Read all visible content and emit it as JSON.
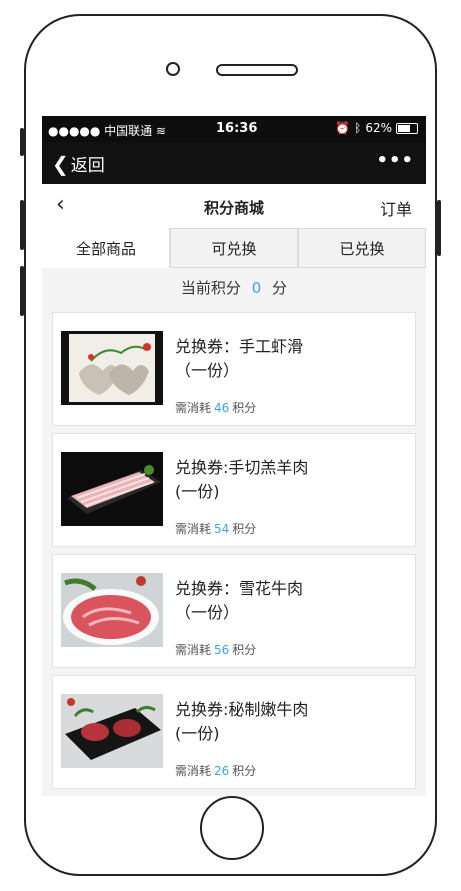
{
  "status": {
    "carrier": "●●●●● 中国联通",
    "time": "16:36",
    "battery": "62%"
  },
  "nav": {
    "back_label": "返回",
    "more_label": "•••"
  },
  "titlebar": {
    "title": "积分商城",
    "orders": "订单"
  },
  "tabs": [
    {
      "label": "全部商品",
      "active": true
    },
    {
      "label": "可兑换",
      "active": false
    },
    {
      "label": "已兑换",
      "active": false
    }
  ],
  "points": {
    "prefix": "当前积分",
    "value": "0",
    "suffix": "分"
  },
  "items": [
    {
      "name_line1": "兑换券：手工虾滑",
      "name_line2": "（一份）",
      "cost_prefix": "需消耗",
      "cost": "46",
      "cost_suffix": "积分"
    },
    {
      "name_line1": "兑换券:手切羔羊肉",
      "name_line2": "(一份)",
      "cost_prefix": "需消耗",
      "cost": "54",
      "cost_suffix": "积分"
    },
    {
      "name_line1": "兑换券：雪花牛肉",
      "name_line2": "（一份）",
      "cost_prefix": "需消耗",
      "cost": "56",
      "cost_suffix": "积分"
    },
    {
      "name_line1": "兑换券:秘制嫩牛肉",
      "name_line2": "(一份)",
      "cost_prefix": "需消耗",
      "cost": "26",
      "cost_suffix": "积分"
    }
  ]
}
